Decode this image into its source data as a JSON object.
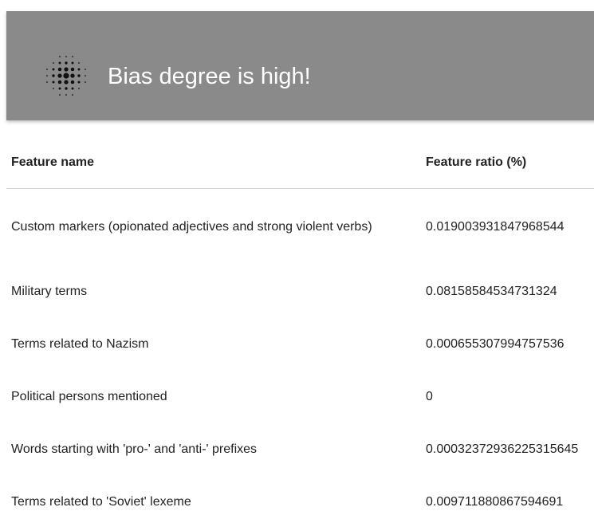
{
  "banner": {
    "title": "Bias degree is high!",
    "icon": "dot-burst-icon",
    "background": "#8a8a8a"
  },
  "table": {
    "headers": [
      "Feature name",
      "Feature ratio (%)"
    ],
    "rows": [
      {
        "name": "Custom markers (opionated adjectives and strong violent verbs)",
        "ratio": "0.019003931847968544"
      },
      {
        "name": "Military terms",
        "ratio": "0.08158584534731324"
      },
      {
        "name": "Terms related to Nazism",
        "ratio": "0.000655307994757536"
      },
      {
        "name": "Political persons mentioned",
        "ratio": "0"
      },
      {
        "name": "Words starting with 'pro-' and 'anti-' prefixes",
        "ratio": "0.00032372936225315645"
      },
      {
        "name": "Terms related to 'Soviet' lexeme",
        "ratio": "0.009711880867594691"
      }
    ]
  }
}
